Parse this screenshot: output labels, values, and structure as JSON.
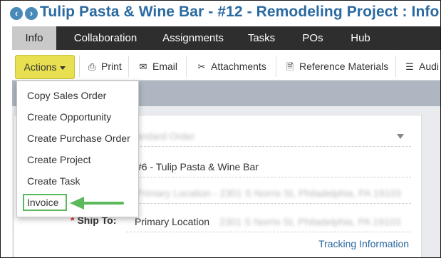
{
  "header": {
    "back_icon": "arrow-left-circle-icon",
    "forward_icon": "arrow-right-circle-icon",
    "title": "Tulip Pasta & Wine Bar - #12 - Remodeling Project : Info"
  },
  "tabs": [
    {
      "label": "Info",
      "active": true
    },
    {
      "label": "Collaboration"
    },
    {
      "label": "Assignments"
    },
    {
      "label": "Tasks"
    },
    {
      "label": "POs"
    },
    {
      "label": "Hub"
    }
  ],
  "toolbar": {
    "actions_label": "Actions",
    "print_label": "Print",
    "email_label": "Email",
    "attachments_label": "Attachments",
    "reference_label": "Reference Materials",
    "audit_label": "Audi"
  },
  "actions_menu": {
    "items": [
      "Copy Sales Order",
      "Create Opportunity",
      "Create Purchase Order",
      "Create Project",
      "Create Task",
      "Invoice"
    ],
    "highlighted": "Invoice",
    "highlight_color": "#5cb85c"
  },
  "form": {
    "row1_value": "Standard Order",
    "row2_value": "#6 - Tulip Pasta & Wine Bar",
    "row3_value": "Primary Location - 2301 S Norris St, Philadelphia, PA 19103",
    "ship_to_label": "Ship To:",
    "ship_to_required": "*",
    "ship_to_value": "Primary Location",
    "ship_to_address": "2301 S Norris St, Philadelphia, PA 19103",
    "tracking_link": "Tracking Information"
  },
  "colors": {
    "title": "#2b6aa0",
    "tabbar": "#2e2e2e",
    "actions_button": "#e8e050",
    "accent_green": "#5cb85c"
  }
}
